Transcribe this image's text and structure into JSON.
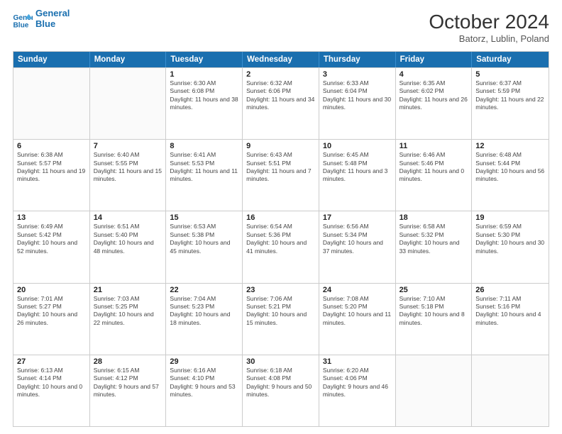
{
  "header": {
    "logo_line1": "General",
    "logo_line2": "Blue",
    "month": "October 2024",
    "location": "Batorz, Lublin, Poland"
  },
  "days_of_week": [
    "Sunday",
    "Monday",
    "Tuesday",
    "Wednesday",
    "Thursday",
    "Friday",
    "Saturday"
  ],
  "weeks": [
    [
      {
        "day": "",
        "info": ""
      },
      {
        "day": "",
        "info": ""
      },
      {
        "day": "1",
        "info": "Sunrise: 6:30 AM\nSunset: 6:08 PM\nDaylight: 11 hours and 38 minutes."
      },
      {
        "day": "2",
        "info": "Sunrise: 6:32 AM\nSunset: 6:06 PM\nDaylight: 11 hours and 34 minutes."
      },
      {
        "day": "3",
        "info": "Sunrise: 6:33 AM\nSunset: 6:04 PM\nDaylight: 11 hours and 30 minutes."
      },
      {
        "day": "4",
        "info": "Sunrise: 6:35 AM\nSunset: 6:02 PM\nDaylight: 11 hours and 26 minutes."
      },
      {
        "day": "5",
        "info": "Sunrise: 6:37 AM\nSunset: 5:59 PM\nDaylight: 11 hours and 22 minutes."
      }
    ],
    [
      {
        "day": "6",
        "info": "Sunrise: 6:38 AM\nSunset: 5:57 PM\nDaylight: 11 hours and 19 minutes."
      },
      {
        "day": "7",
        "info": "Sunrise: 6:40 AM\nSunset: 5:55 PM\nDaylight: 11 hours and 15 minutes."
      },
      {
        "day": "8",
        "info": "Sunrise: 6:41 AM\nSunset: 5:53 PM\nDaylight: 11 hours and 11 minutes."
      },
      {
        "day": "9",
        "info": "Sunrise: 6:43 AM\nSunset: 5:51 PM\nDaylight: 11 hours and 7 minutes."
      },
      {
        "day": "10",
        "info": "Sunrise: 6:45 AM\nSunset: 5:48 PM\nDaylight: 11 hours and 3 minutes."
      },
      {
        "day": "11",
        "info": "Sunrise: 6:46 AM\nSunset: 5:46 PM\nDaylight: 11 hours and 0 minutes."
      },
      {
        "day": "12",
        "info": "Sunrise: 6:48 AM\nSunset: 5:44 PM\nDaylight: 10 hours and 56 minutes."
      }
    ],
    [
      {
        "day": "13",
        "info": "Sunrise: 6:49 AM\nSunset: 5:42 PM\nDaylight: 10 hours and 52 minutes."
      },
      {
        "day": "14",
        "info": "Sunrise: 6:51 AM\nSunset: 5:40 PM\nDaylight: 10 hours and 48 minutes."
      },
      {
        "day": "15",
        "info": "Sunrise: 6:53 AM\nSunset: 5:38 PM\nDaylight: 10 hours and 45 minutes."
      },
      {
        "day": "16",
        "info": "Sunrise: 6:54 AM\nSunset: 5:36 PM\nDaylight: 10 hours and 41 minutes."
      },
      {
        "day": "17",
        "info": "Sunrise: 6:56 AM\nSunset: 5:34 PM\nDaylight: 10 hours and 37 minutes."
      },
      {
        "day": "18",
        "info": "Sunrise: 6:58 AM\nSunset: 5:32 PM\nDaylight: 10 hours and 33 minutes."
      },
      {
        "day": "19",
        "info": "Sunrise: 6:59 AM\nSunset: 5:30 PM\nDaylight: 10 hours and 30 minutes."
      }
    ],
    [
      {
        "day": "20",
        "info": "Sunrise: 7:01 AM\nSunset: 5:27 PM\nDaylight: 10 hours and 26 minutes."
      },
      {
        "day": "21",
        "info": "Sunrise: 7:03 AM\nSunset: 5:25 PM\nDaylight: 10 hours and 22 minutes."
      },
      {
        "day": "22",
        "info": "Sunrise: 7:04 AM\nSunset: 5:23 PM\nDaylight: 10 hours and 18 minutes."
      },
      {
        "day": "23",
        "info": "Sunrise: 7:06 AM\nSunset: 5:21 PM\nDaylight: 10 hours and 15 minutes."
      },
      {
        "day": "24",
        "info": "Sunrise: 7:08 AM\nSunset: 5:20 PM\nDaylight: 10 hours and 11 minutes."
      },
      {
        "day": "25",
        "info": "Sunrise: 7:10 AM\nSunset: 5:18 PM\nDaylight: 10 hours and 8 minutes."
      },
      {
        "day": "26",
        "info": "Sunrise: 7:11 AM\nSunset: 5:16 PM\nDaylight: 10 hours and 4 minutes."
      }
    ],
    [
      {
        "day": "27",
        "info": "Sunrise: 6:13 AM\nSunset: 4:14 PM\nDaylight: 10 hours and 0 minutes."
      },
      {
        "day": "28",
        "info": "Sunrise: 6:15 AM\nSunset: 4:12 PM\nDaylight: 9 hours and 57 minutes."
      },
      {
        "day": "29",
        "info": "Sunrise: 6:16 AM\nSunset: 4:10 PM\nDaylight: 9 hours and 53 minutes."
      },
      {
        "day": "30",
        "info": "Sunrise: 6:18 AM\nSunset: 4:08 PM\nDaylight: 9 hours and 50 minutes."
      },
      {
        "day": "31",
        "info": "Sunrise: 6:20 AM\nSunset: 4:06 PM\nDaylight: 9 hours and 46 minutes."
      },
      {
        "day": "",
        "info": ""
      },
      {
        "day": "",
        "info": ""
      }
    ]
  ]
}
